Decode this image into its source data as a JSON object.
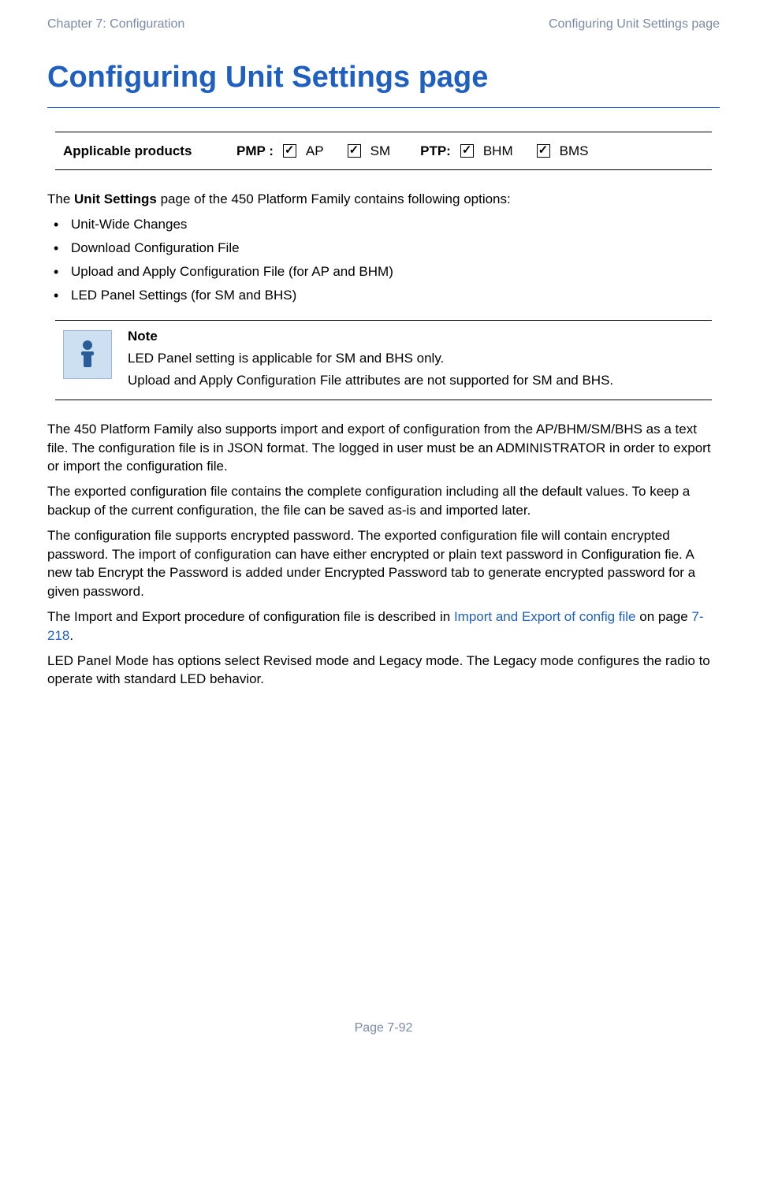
{
  "header": {
    "left": "Chapter 7:  Configuration",
    "right": "Configuring Unit Settings page"
  },
  "title": "Configuring Unit Settings page",
  "products": {
    "label": "Applicable products",
    "pmp_label": "PMP :",
    "ptp_label": "PTP:",
    "items_pmp": [
      {
        "label": "AP",
        "checked": true
      },
      {
        "label": "SM",
        "checked": true
      }
    ],
    "items_ptp": [
      {
        "label": "BHM",
        "checked": true
      },
      {
        "label": "BMS",
        "checked": true
      }
    ]
  },
  "intro": {
    "prefix": "The ",
    "bold": "Unit Settings",
    "suffix": " page of the 450 Platform Family contains following options:"
  },
  "bullets": [
    "Unit-Wide Changes",
    "Download Configuration File",
    "Upload and Apply Configuration File (for AP and BHM)",
    "LED Panel Settings (for SM and BHS)"
  ],
  "note": {
    "title": "Note",
    "line1": "LED Panel setting is applicable for SM and BHS only.",
    "line2": "Upload and Apply Configuration File attributes are not supported for SM and BHS."
  },
  "paragraphs": {
    "p1": "The 450 Platform Family also supports import and export of configuration from the AP/BHM/SM/BHS as a text file. The configuration file is in JSON format. The logged in user must be an ADMINISTRATOR in order to export or import the configuration file.",
    "p2": "The exported configuration file contains the complete configuration including all the default values. To keep a backup of the current configuration, the file can be saved as-is and imported later.",
    "p3": "The configuration file supports encrypted password. The exported configuration file will contain encrypted password. The import of configuration can have either encrypted or plain text password in Configuration fie. A new tab Encrypt the Password is added under Encrypted Password tab to generate encrypted password for a given password.",
    "p4_prefix": "The Import and Export procedure of configuration file is described in ",
    "p4_link1": "Import and Export of config file",
    "p4_mid": " on page ",
    "p4_link2": "7-218",
    "p4_suffix": ".",
    "p5": "LED Panel Mode has options select Revised mode and Legacy mode. The Legacy mode configures the radio to operate with standard LED behavior."
  },
  "footer": "Page 7-92"
}
